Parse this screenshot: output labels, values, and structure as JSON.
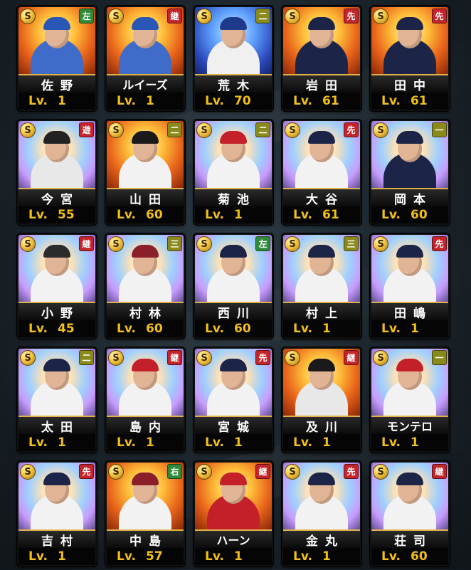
{
  "rarity_symbol": "S",
  "cards": [
    {
      "name": "佐野",
      "pos": "左",
      "pos_color": "green",
      "lv_label": "Lv.",
      "level": "1",
      "bg": "fire",
      "uniform": "#3f6bc9",
      "cap": "#2a57b5"
    },
    {
      "name": "ルイーズ",
      "pos": "継",
      "pos_color": "red",
      "lv_label": "Lv.",
      "level": "1",
      "bg": "fire",
      "uniform": "#3f6bc9",
      "cap": "#2a57b5"
    },
    {
      "name": "荒木",
      "pos": "二",
      "pos_color": "olive",
      "lv_label": "Lv.",
      "level": "70",
      "bg": "blue",
      "uniform": "#f0f0f0",
      "cap": "#1f3a8a"
    },
    {
      "name": "岩田",
      "pos": "先",
      "pos_color": "red",
      "lv_label": "Lv.",
      "level": "61",
      "bg": "fire",
      "uniform": "#1c2448",
      "cap": "#1c2448"
    },
    {
      "name": "田中",
      "pos": "先",
      "pos_color": "red",
      "lv_label": "Lv.",
      "level": "61",
      "bg": "fire",
      "uniform": "#1c2448",
      "cap": "#1c2448"
    },
    {
      "name": "今宮",
      "pos": "遊",
      "pos_color": "red",
      "lv_label": "Lv.",
      "level": "55",
      "bg": "prism",
      "uniform": "#e8e8e8",
      "cap": "#222222"
    },
    {
      "name": "山田",
      "pos": "二",
      "pos_color": "olive",
      "lv_label": "Lv.",
      "level": "60",
      "bg": "fire",
      "uniform": "#f2f2f2",
      "cap": "#1a1a1a"
    },
    {
      "name": "菊池",
      "pos": "二",
      "pos_color": "olive",
      "lv_label": "Lv.",
      "level": "1",
      "bg": "prism",
      "uniform": "#f2f2f2",
      "cap": "#c3202a"
    },
    {
      "name": "大谷",
      "pos": "先",
      "pos_color": "red",
      "lv_label": "Lv.",
      "level": "61",
      "bg": "prism",
      "uniform": "#f2f2f2",
      "cap": "#1c2448"
    },
    {
      "name": "岡本",
      "pos": "一",
      "pos_color": "olive",
      "lv_label": "Lv.",
      "level": "60",
      "bg": "prism",
      "uniform": "#1c2448",
      "cap": "#1c2448"
    },
    {
      "name": "小野",
      "pos": "継",
      "pos_color": "red",
      "lv_label": "Lv.",
      "level": "45",
      "bg": "prism",
      "uniform": "#f2f2f2",
      "cap": "#2b2b2b"
    },
    {
      "name": "村林",
      "pos": "三",
      "pos_color": "olive",
      "lv_label": "Lv.",
      "level": "60",
      "bg": "prism",
      "uniform": "#f2f2f2",
      "cap": "#8a1f2a"
    },
    {
      "name": "西川",
      "pos": "左",
      "pos_color": "green",
      "lv_label": "Lv.",
      "level": "60",
      "bg": "prism",
      "uniform": "#f2f2f2",
      "cap": "#1c2448"
    },
    {
      "name": "村上",
      "pos": "三",
      "pos_color": "olive",
      "lv_label": "Lv.",
      "level": "1",
      "bg": "prism",
      "uniform": "#f2f2f2",
      "cap": "#1c2448"
    },
    {
      "name": "田嶋",
      "pos": "先",
      "pos_color": "red",
      "lv_label": "Lv.",
      "level": "1",
      "bg": "prism",
      "uniform": "#f2f2f2",
      "cap": "#1c2448"
    },
    {
      "name": "太田",
      "pos": "二",
      "pos_color": "olive",
      "lv_label": "Lv.",
      "level": "1",
      "bg": "prism",
      "uniform": "#f2f2f2",
      "cap": "#1c2448"
    },
    {
      "name": "島内",
      "pos": "継",
      "pos_color": "red",
      "lv_label": "Lv.",
      "level": "1",
      "bg": "prism",
      "uniform": "#f2f2f2",
      "cap": "#c3202a"
    },
    {
      "name": "宮城",
      "pos": "先",
      "pos_color": "red",
      "lv_label": "Lv.",
      "level": "1",
      "bg": "prism",
      "uniform": "#f2f2f2",
      "cap": "#1c2448"
    },
    {
      "name": "及川",
      "pos": "継",
      "pos_color": "red",
      "lv_label": "Lv.",
      "level": "1",
      "bg": "fire",
      "uniform": "#e8e8e8",
      "cap": "#1a1a1a"
    },
    {
      "name": "モンテロ",
      "pos": "一",
      "pos_color": "olive",
      "lv_label": "Lv.",
      "level": "1",
      "bg": "prism",
      "uniform": "#f2f2f2",
      "cap": "#c3202a"
    },
    {
      "name": "吉村",
      "pos": "先",
      "pos_color": "red",
      "lv_label": "Lv.",
      "level": "1",
      "bg": "prism",
      "uniform": "#f2f2f2",
      "cap": "#1c2448"
    },
    {
      "name": "中島",
      "pos": "右",
      "pos_color": "green",
      "lv_label": "Lv.",
      "level": "57",
      "bg": "fire",
      "uniform": "#f2f2f2",
      "cap": "#8a1f2a"
    },
    {
      "name": "ハーン",
      "pos": "継",
      "pos_color": "red",
      "lv_label": "Lv.",
      "level": "1",
      "bg": "fire",
      "uniform": "#c3202a",
      "cap": "#c3202a"
    },
    {
      "name": "金丸",
      "pos": "先",
      "pos_color": "red",
      "lv_label": "Lv.",
      "level": "1",
      "bg": "prism",
      "uniform": "#f2f2f2",
      "cap": "#1c2448"
    },
    {
      "name": "荘司",
      "pos": "継",
      "pos_color": "red",
      "lv_label": "Lv.",
      "level": "60",
      "bg": "prism",
      "uniform": "#f2f2f2",
      "cap": "#1c2448"
    }
  ]
}
